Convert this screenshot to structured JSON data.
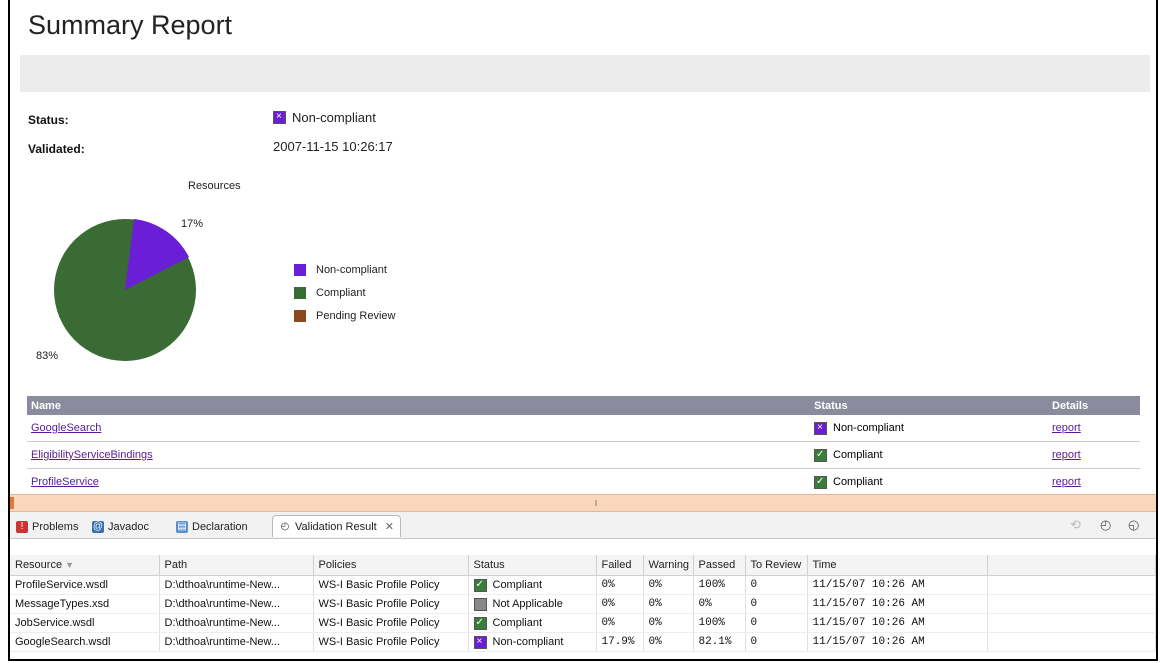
{
  "report": {
    "title": "Summary Report",
    "status_label": "Status:",
    "status_value": "Non-compliant",
    "validated_label": "Validated:",
    "validated_value": "2007-11-15 10:26:17",
    "chart_title": "Resources",
    "pie_pct_small": "17%",
    "pie_pct_large": "83%",
    "legend": [
      {
        "label": "Non-compliant",
        "color": "#6a1ed6"
      },
      {
        "label": "Compliant",
        "color": "#3a6b35"
      },
      {
        "label": "Pending Review",
        "color": "#8a4a1c"
      }
    ],
    "table_headers": {
      "name": "Name",
      "status": "Status",
      "details": "Details"
    },
    "rows": [
      {
        "name": "GoogleSearch",
        "status": "Non-compliant",
        "details": "report"
      },
      {
        "name": "EligibilityServiceBindings",
        "status": "Compliant",
        "details": "report"
      },
      {
        "name": "ProfileService",
        "status": "Compliant",
        "details": "report"
      }
    ]
  },
  "tabs": [
    {
      "label": "Problems"
    },
    {
      "label": "Javadoc"
    },
    {
      "label": "Declaration"
    },
    {
      "label": "Validation Result"
    }
  ],
  "grid": {
    "headers": [
      "Resource",
      "Path",
      "Policies",
      "Status",
      "Failed",
      "Warning",
      "Passed",
      "To Review",
      "Time"
    ],
    "rows": [
      [
        "ProfileService.wsdl",
        "D:\\dthoa\\runtime-New...",
        "WS-I Basic Profile Policy",
        "Compliant",
        "0%",
        "0%",
        "100%",
        "0",
        "11/15/07 10:26 AM"
      ],
      [
        "MessageTypes.xsd",
        "D:\\dthoa\\runtime-New...",
        "WS-I Basic Profile Policy",
        "Not Applicable",
        "0%",
        "0%",
        "0%",
        "0",
        "11/15/07 10:26 AM"
      ],
      [
        "JobService.wsdl",
        "D:\\dthoa\\runtime-New...",
        "WS-I Basic Profile Policy",
        "Compliant",
        "0%",
        "0%",
        "100%",
        "0",
        "11/15/07 10:26 AM"
      ],
      [
        "GoogleSearch.wsdl",
        "D:\\dthoa\\runtime-New...",
        "WS-I Basic Profile Policy",
        "Non-compliant",
        "17.9%",
        "0%",
        "82.1%",
        "0",
        "11/15/07 10:26 AM"
      ]
    ]
  },
  "colors": {
    "noncompliant": "#6a1ed6",
    "compliant": "#3a6b35",
    "pending": "#8a4a1c"
  }
}
